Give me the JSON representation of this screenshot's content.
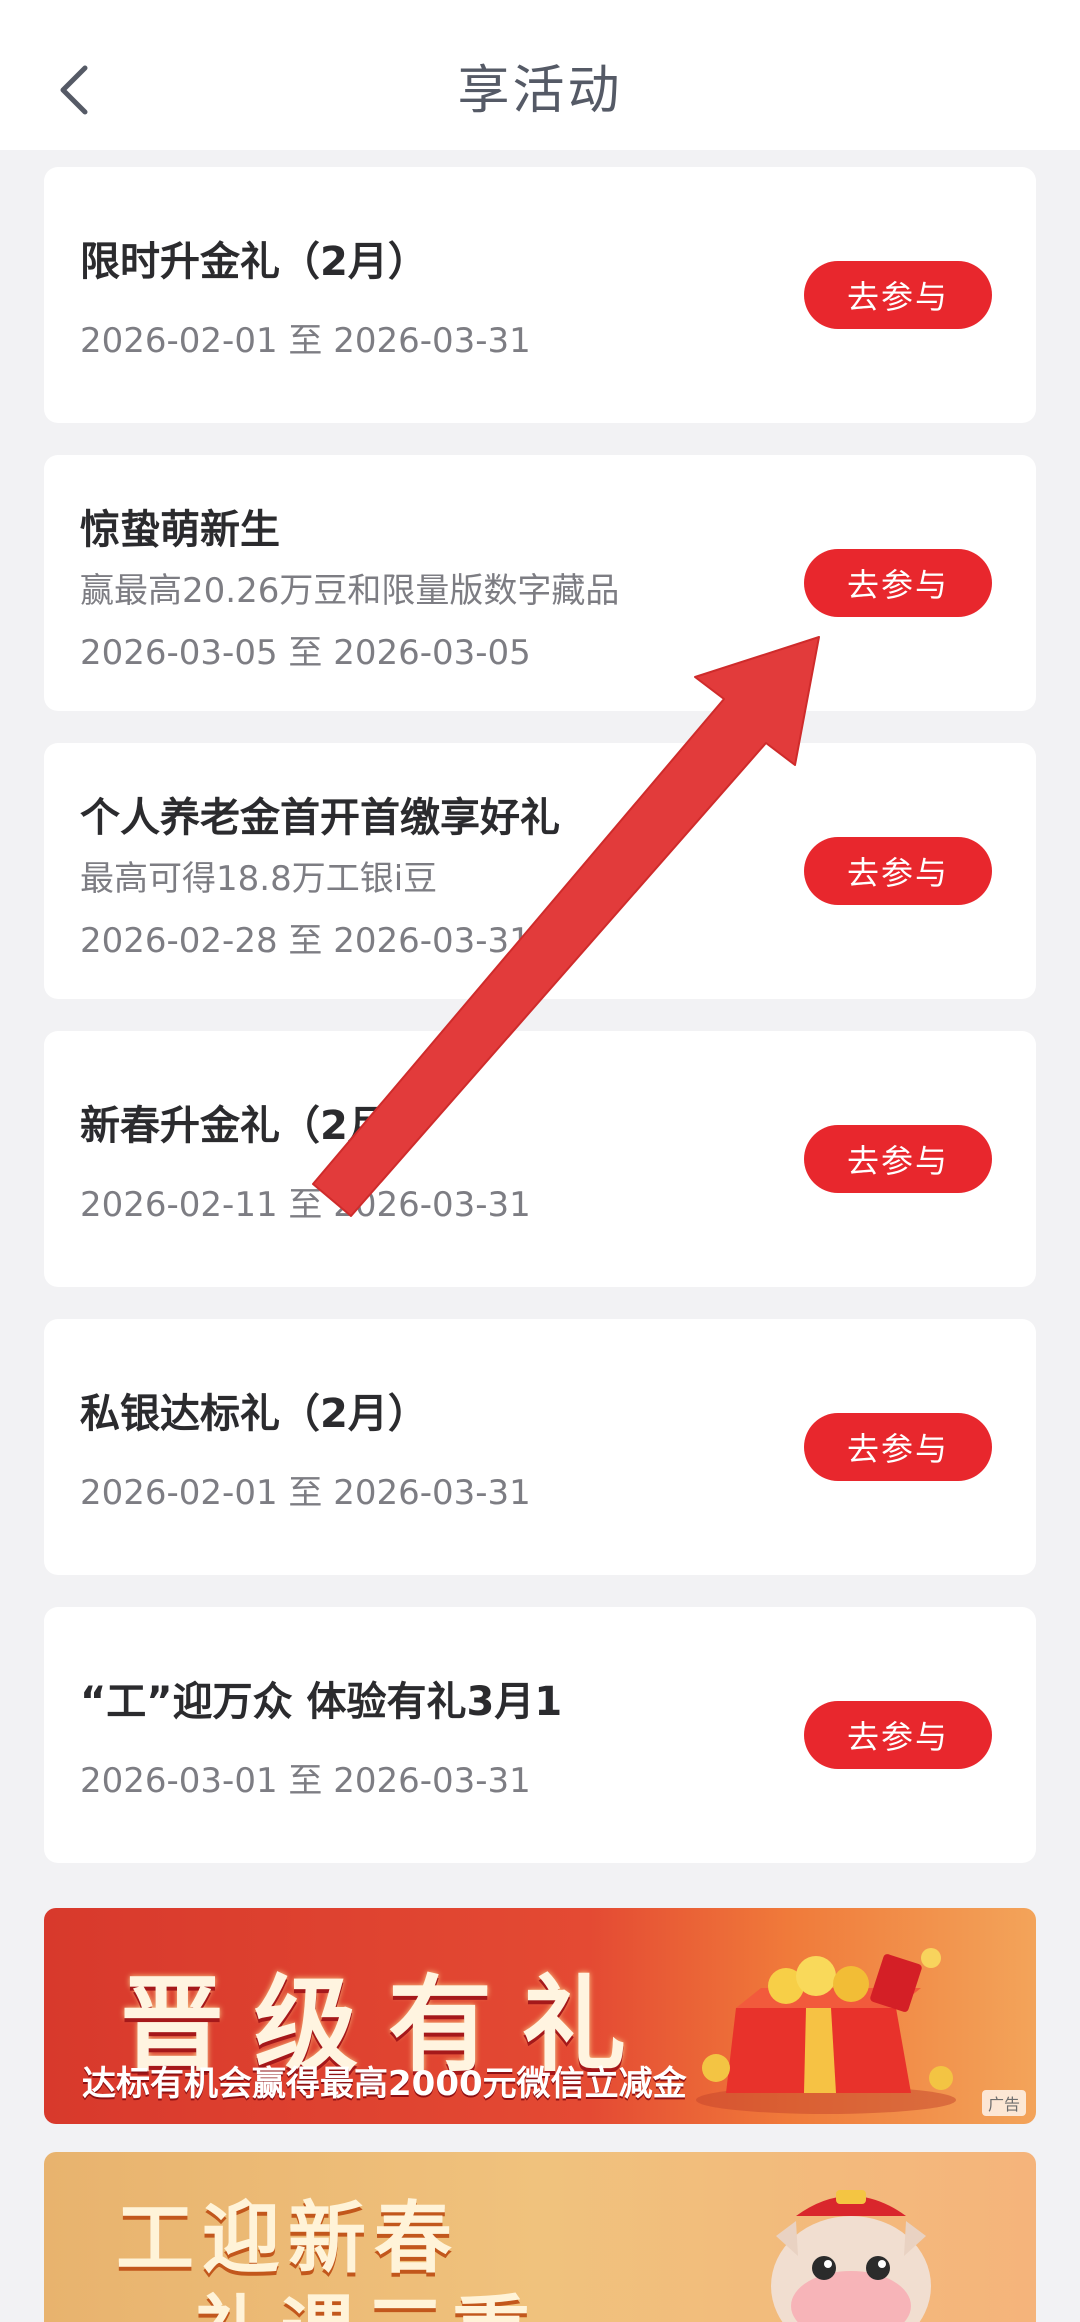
{
  "header": {
    "title": "享活动",
    "back": "back"
  },
  "activities": [
    {
      "title": "限时升金礼（2月）",
      "subtitle": "",
      "date": "2026-02-01 至 2026-03-31",
      "action": "去参与"
    },
    {
      "title": "惊蛰萌新生",
      "subtitle": "赢最高20.26万豆和限量版数字藏品",
      "date": "2026-03-05 至 2026-03-05",
      "action": "去参与"
    },
    {
      "title": "个人养老金首开首缴享好礼",
      "subtitle": "最高可得18.8万工银i豆",
      "date": "2026-02-28 至 2026-03-31",
      "action": "去参与"
    },
    {
      "title": "新春升金礼（2月）",
      "subtitle": "",
      "date": "2026-02-11 至 2026-03-31",
      "action": "去参与"
    },
    {
      "title": "私银达标礼（2月）",
      "subtitle": "",
      "date": "2026-02-01 至 2026-03-31",
      "action": "去参与"
    },
    {
      "title": "“工”迎万众 体验有礼3月1",
      "subtitle": "",
      "date": "2026-03-01 至 2026-03-31",
      "action": "去参与"
    }
  ],
  "banners": {
    "upgrade": {
      "headline": "晋级有礼",
      "subline": "达标有机会赢得最高2000元微信立减金",
      "ad": "广告"
    },
    "newyear": {
      "line1": "工迎新春",
      "line2": "礼遇三重"
    }
  },
  "colors": {
    "accent": "#e8272d",
    "arrow": "#e23b3b"
  }
}
